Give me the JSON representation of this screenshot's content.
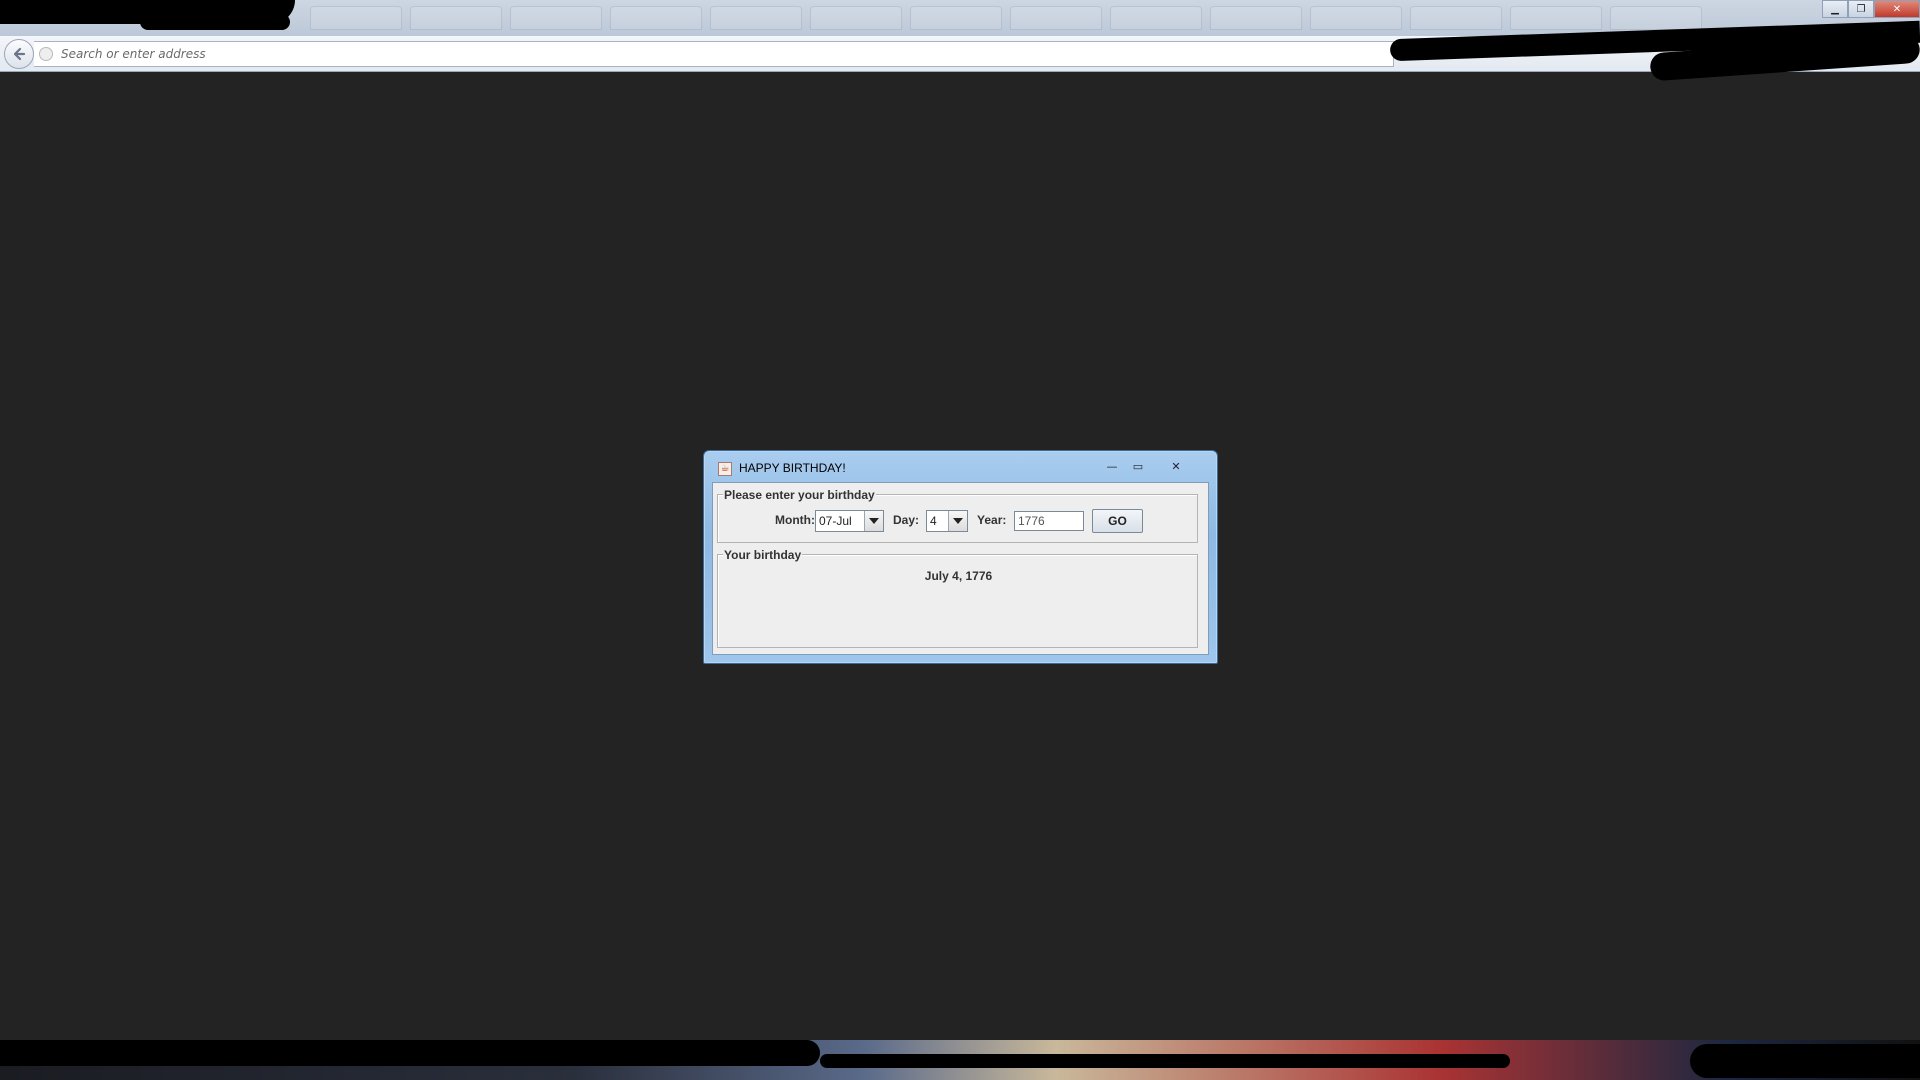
{
  "browser": {
    "url_placeholder": "Search or enter address"
  },
  "window_controls": {
    "minimize": "▁",
    "maximize": "❐",
    "close": "✕"
  },
  "dialog": {
    "title": "HAPPY BIRTHDAY!",
    "controls": {
      "minimize": "—",
      "maximize": "▭",
      "close": "✕"
    },
    "input_group": {
      "legend": "Please enter your birthday",
      "month_label": "Month:",
      "month_value": "07-Jul",
      "day_label": "Day:",
      "day_value": "4",
      "year_label": "Year:",
      "year_value": "1776",
      "go_label": "GO"
    },
    "result_group": {
      "legend": "Your birthday",
      "result": "July 4, 1776"
    }
  },
  "icons": {
    "back": "back-arrow-icon",
    "globe": "globe-icon",
    "java": "java-cup-icon",
    "dropdown": "chevron-down-icon"
  },
  "colors": {
    "desktop_bg": "#232323",
    "dialog_title_bar": "#9fc6ec",
    "dialog_body": "#eeeeee"
  }
}
